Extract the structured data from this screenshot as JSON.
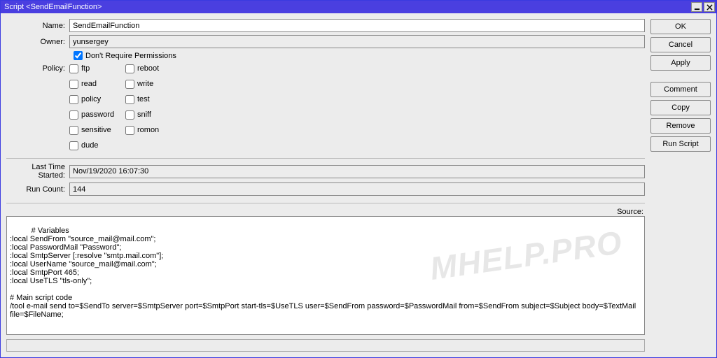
{
  "window": {
    "title": "Script <SendEmailFunction>"
  },
  "buttons": {
    "ok": "OK",
    "cancel": "Cancel",
    "apply": "Apply",
    "comment": "Comment",
    "copy": "Copy",
    "remove": "Remove",
    "run": "Run Script"
  },
  "labels": {
    "name": "Name:",
    "owner": "Owner:",
    "policy": "Policy:",
    "dont_require": "Don't Require Permissions",
    "last_time": "Last Time Started:",
    "run_count": "Run Count:",
    "source": "Source:"
  },
  "fields": {
    "name": "SendEmailFunction",
    "owner": "yunsergey",
    "last_time": "Nov/19/2020 16:07:30",
    "run_count": "144",
    "dont_require_checked": true
  },
  "policy": {
    "col1": [
      {
        "key": "ftp",
        "label": "ftp",
        "checked": false
      },
      {
        "key": "read",
        "label": "read",
        "checked": false
      },
      {
        "key": "policy",
        "label": "policy",
        "checked": false
      },
      {
        "key": "password",
        "label": "password",
        "checked": false
      },
      {
        "key": "sensitive",
        "label": "sensitive",
        "checked": false
      },
      {
        "key": "dude",
        "label": "dude",
        "checked": false
      }
    ],
    "col2": [
      {
        "key": "reboot",
        "label": "reboot",
        "checked": false
      },
      {
        "key": "write",
        "label": "write",
        "checked": false
      },
      {
        "key": "test",
        "label": "test",
        "checked": false
      },
      {
        "key": "sniff",
        "label": "sniff",
        "checked": false
      },
      {
        "key": "romon",
        "label": "romon",
        "checked": false
      }
    ]
  },
  "source": "# Variables\n:local SendFrom \"source_mail@mail.com\";\n:local PasswordMail \"Password\";\n:local SmtpServer [:resolve \"smtp.mail.com\"];\n:local UserName \"source_mail@mail.com\";\n:local SmtpPort 465;\n:local UseTLS \"tls-only\";\n\n# Main script code\n/tool e-mail send to=$SendTo server=$SmtpServer port=$SmtpPort start-tls=$UseTLS user=$SendFrom password=$PasswordMail from=$SendFrom subject=$Subject body=$TextMail file=$FileName;",
  "watermark": "MHELP.PRO"
}
